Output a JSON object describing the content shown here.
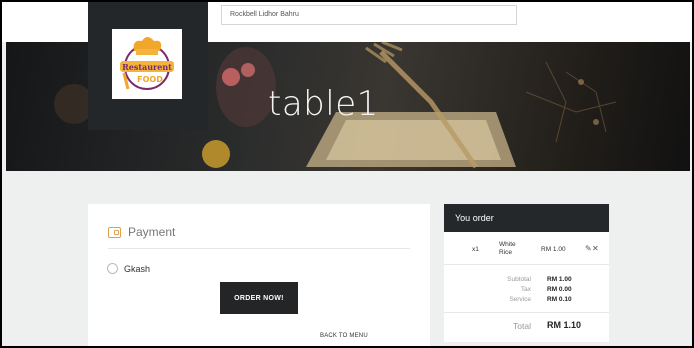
{
  "address": {
    "text": "Rockbell Lidhor Bahru"
  },
  "hero": {
    "title": "table1"
  },
  "logo": {
    "word1": "Restaurent",
    "word2": "FOOD"
  },
  "payment": {
    "title": "Payment",
    "method_label": "Gkash",
    "order_button": "ORDER NOW!",
    "back_link": "BACK TO MENU"
  },
  "order": {
    "title": "You order",
    "items": [
      {
        "qty": "x1",
        "name": "White Rice",
        "price": "RM 1.00"
      }
    ],
    "subtotal_label": "Subtotal",
    "subtotal_value": "RM 1.00",
    "tax_label": "Tax",
    "tax_value": "RM 0.00",
    "service_label": "Service",
    "service_value": "RM 0.10",
    "total_label": "Total",
    "total_value": "RM 1.10"
  },
  "colors": {
    "accent": "#e0a050",
    "dark": "#24272a",
    "background": "#eef0ef"
  },
  "icons": {
    "payment": "wallet-icon",
    "edit": "pencil-icon",
    "delete": "close-icon"
  }
}
